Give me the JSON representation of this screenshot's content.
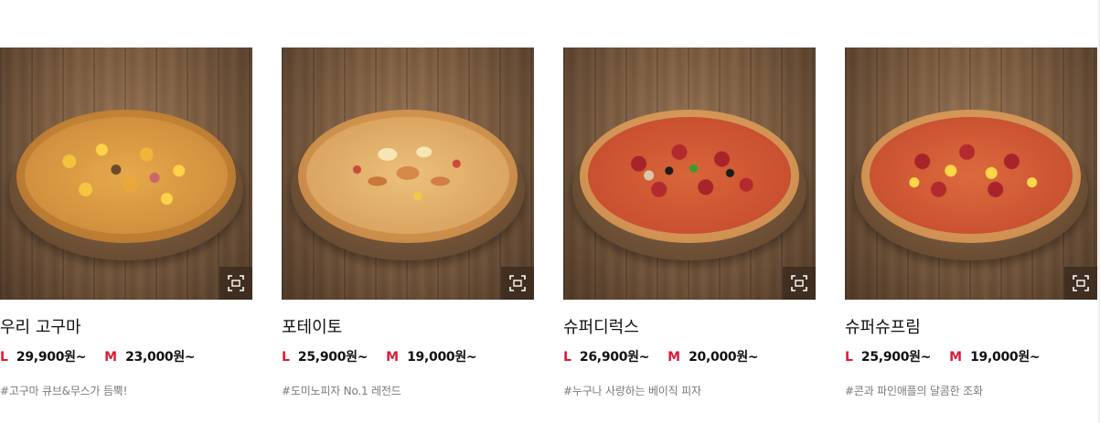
{
  "products": [
    {
      "name": "우리 고구마",
      "size_l": "L",
      "price_l": "29,900원~",
      "size_m": "M",
      "price_m": "23,000원~",
      "description": "#고구마 큐브&무스가 듬뿍!"
    },
    {
      "name": "포테이토",
      "size_l": "L",
      "price_l": "25,900원~",
      "size_m": "M",
      "price_m": "19,000원~",
      "description": "#도미노피자 No.1 레전드"
    },
    {
      "name": "슈퍼디럭스",
      "size_l": "L",
      "price_l": "26,900원~",
      "size_m": "M",
      "price_m": "20,000원~",
      "description": "#누구나 사랑하는 베이직 피자"
    },
    {
      "name": "슈퍼슈프림",
      "size_l": "L",
      "price_l": "25,900원~",
      "size_m": "M",
      "price_m": "19,000원~",
      "description": "#콘과 파인애플의 달콤한 조화"
    }
  ],
  "icons": {
    "zoom": "expand-icon"
  },
  "colors": {
    "size_label": "#e31837",
    "text": "#111111",
    "description": "#7a7a7a"
  }
}
